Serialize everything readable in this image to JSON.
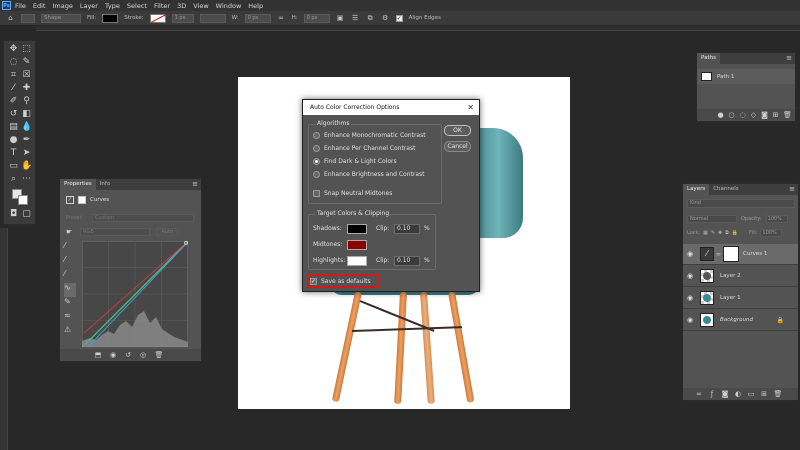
{
  "app": {
    "logo": "Ps"
  },
  "menu": [
    "File",
    "Edit",
    "Image",
    "Layer",
    "Type",
    "Select",
    "Filter",
    "3D",
    "View",
    "Window",
    "Help"
  ],
  "options_bar": {
    "shape_label": "Shape",
    "fill_label": "Fill:",
    "stroke_label": "Stroke:",
    "stroke_width": "1 px",
    "w_label": "W:",
    "w_value": "0 px",
    "h_label": "H:",
    "h_value": "0 px",
    "align_edges_label": "Align Edges"
  },
  "paths_panel": {
    "tab": "Paths",
    "items": [
      "Path 1"
    ]
  },
  "properties_panel": {
    "tabs": [
      "Properties",
      "Info"
    ],
    "adjustment": "Curves",
    "preset": "Custom",
    "channel": "RGB",
    "auto_label": "Auto"
  },
  "layers_panel": {
    "tabs": [
      "Layers",
      "Channels"
    ],
    "search": "Kind",
    "blend_mode": "Normal",
    "opacity_label": "Opacity:",
    "opacity": "100%",
    "lock_label": "Lock:",
    "fill_label": "Fill:",
    "fill": "100%",
    "layers": [
      "Curves 1",
      "Layer 2",
      "Layer 1",
      "Background"
    ]
  },
  "dialog": {
    "title": "Auto Color Correction Options",
    "algorithms_title": "Algorithms",
    "algorithms": [
      "Enhance Monochromatic Contrast",
      "Enhance Per Channel Contrast",
      "Find Dark & Light Colors",
      "Enhance Brightness and Contrast"
    ],
    "selected_algorithm": 2,
    "snap_label": "Snap Neutral Midtones",
    "target_title": "Target Colors & Clipping",
    "targets": [
      {
        "label": "Shadows:",
        "color": "#000000",
        "clip_label": "Clip:",
        "clip": "0.10",
        "unit": "%"
      },
      {
        "label": "Midtones:",
        "color": "#8b0000",
        "clip_label": "",
        "clip": "",
        "unit": ""
      },
      {
        "label": "Highlights:",
        "color": "#ffffff",
        "clip_label": "Clip:",
        "clip": "0.10",
        "unit": "%"
      }
    ],
    "save_defaults_label": "Save as defaults",
    "save_defaults_checked": true,
    "ok_label": "OK",
    "cancel_label": "Cancel"
  }
}
